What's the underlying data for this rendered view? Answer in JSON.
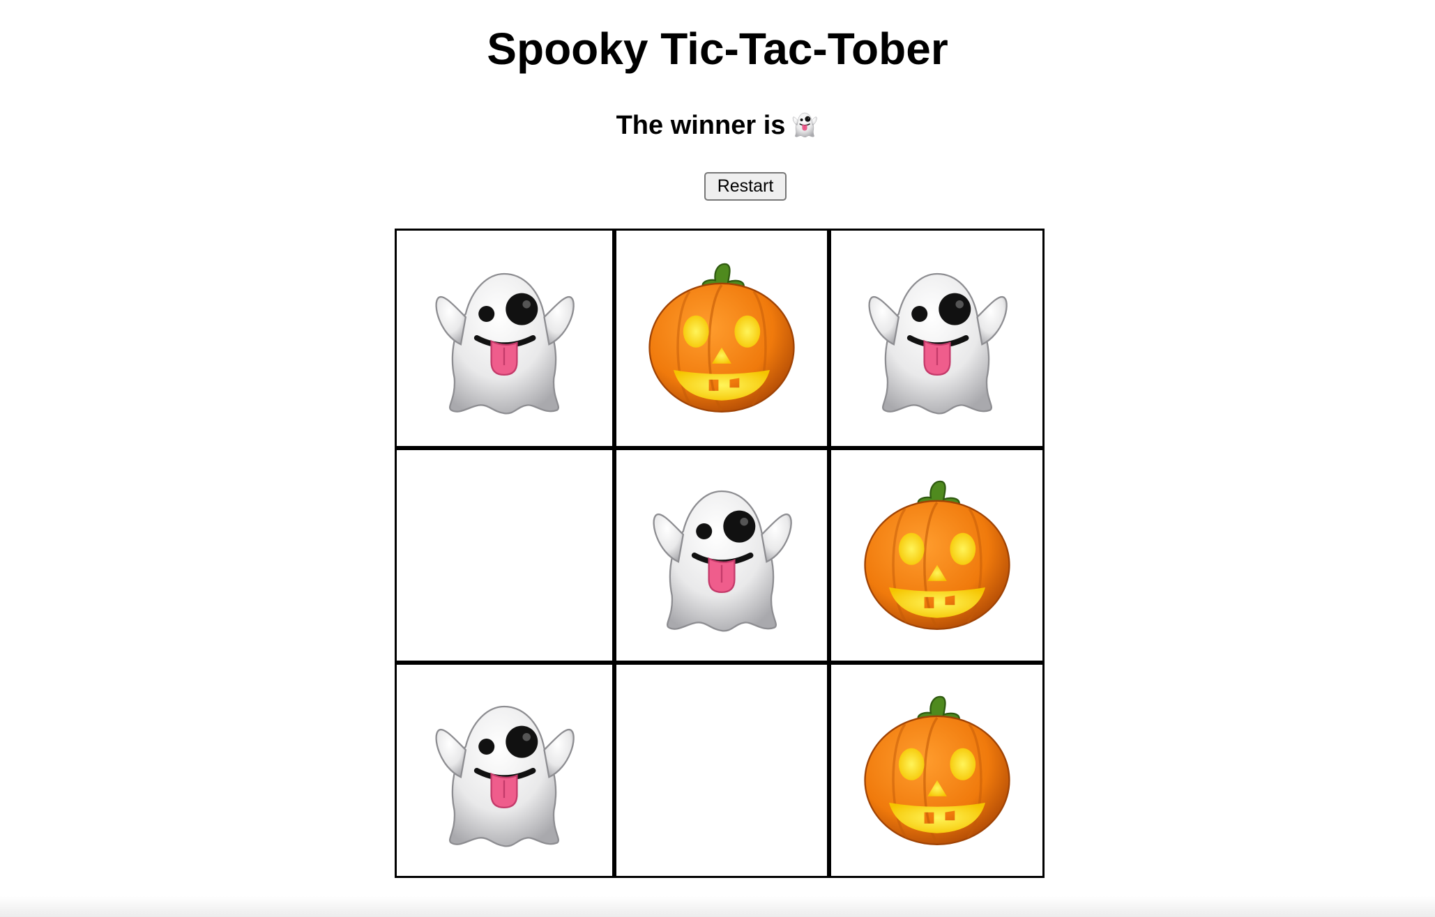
{
  "page": {
    "title": "Spooky Tic-Tac-Tober"
  },
  "status": {
    "text": "The winner is",
    "winner": "ghost"
  },
  "controls": {
    "restart_label": "Restart"
  },
  "pieces": {
    "ghost": {
      "icon": "ghost-icon",
      "emoji": "👻"
    },
    "pumpkin": {
      "icon": "jack-o-lantern-icon",
      "emoji": "🎃"
    }
  },
  "board": {
    "cells": [
      "ghost",
      "pumpkin",
      "ghost",
      "",
      "ghost",
      "pumpkin",
      "ghost",
      "",
      "pumpkin"
    ]
  },
  "colors": {
    "grid_line": "#000000",
    "button_bg": "#efefef",
    "button_border": "#767676",
    "pumpkin_orange": "#f07a0c",
    "pumpkin_face": "#ffe21a",
    "pumpkin_stem": "#4f8a1e",
    "ghost_body": "#f2f2f2",
    "ghost_tongue": "#ef5d8c"
  }
}
